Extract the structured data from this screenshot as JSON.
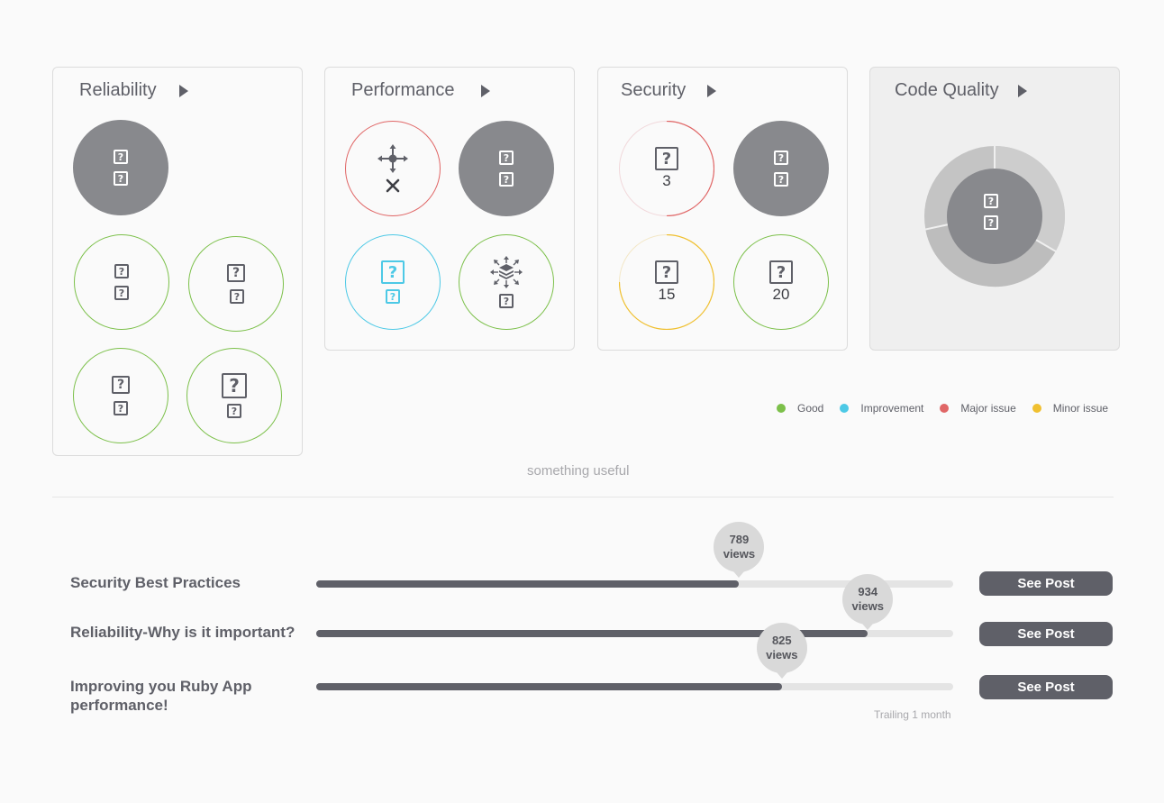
{
  "cards": {
    "reliability": {
      "title": "Reliability"
    },
    "performance": {
      "title": "Performance"
    },
    "security": {
      "title": "Security",
      "counts": [
        "3",
        "15",
        "20"
      ]
    },
    "code_quality": {
      "title": "Code Quality"
    }
  },
  "legend": [
    {
      "label": "Good",
      "color": "#7cc04a"
    },
    {
      "label": "Improvement",
      "color": "#4dc9e6"
    },
    {
      "label": "Major issue",
      "color": "#e06666"
    },
    {
      "label": "Minor issue",
      "color": "#f0c030"
    }
  ],
  "subtle_text": "something useful",
  "posts": [
    {
      "title": "Security Best Practices",
      "views": "789",
      "views_unit": "views",
      "progress": 0.664,
      "button": "See Post"
    },
    {
      "title": "Reliability-Why is it important?",
      "views": "934",
      "views_unit": "views",
      "progress": 0.866,
      "button": "See Post"
    },
    {
      "title": "Improving you Ruby App performance!",
      "views": "825",
      "views_unit": "views",
      "progress": 0.731,
      "button": "See Post"
    }
  ],
  "trailing_label": "Trailing 1 month",
  "icons": {
    "placeholder": "question-box-icon",
    "performance_move": "move-arrows-icon",
    "performance_close": "close-icon",
    "performance_network": "network-layers-icon"
  }
}
